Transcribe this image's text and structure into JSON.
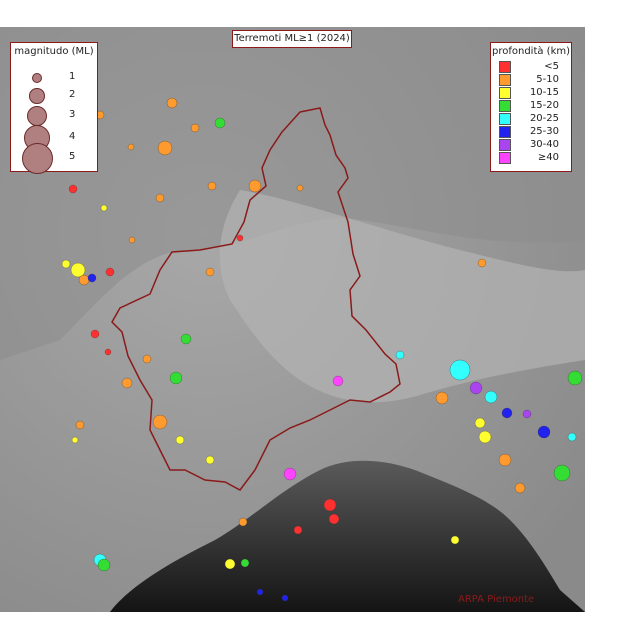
{
  "title": "Terremoti ML≥1 (2024)",
  "credit": "ARPA Piemonte",
  "magnitude_legend": {
    "title": "magnitudo (ML)",
    "items": [
      {
        "label": "1",
        "ml": 1
      },
      {
        "label": "2",
        "ml": 2
      },
      {
        "label": "3",
        "ml": 3
      },
      {
        "label": "4",
        "ml": 4
      },
      {
        "label": "5",
        "ml": 5
      }
    ]
  },
  "depth_legend": {
    "title": "profondità (km)",
    "items": [
      {
        "label": "<5",
        "color": "#ff3030"
      },
      {
        "label": "5-10",
        "color": "#ff9a2e"
      },
      {
        "label": "10-15",
        "color": "#ffff30"
      },
      {
        "label": "15-20",
        "color": "#33dd33"
      },
      {
        "label": "20-25",
        "color": "#33ffff"
      },
      {
        "label": "25-30",
        "color": "#2222ee"
      },
      {
        "label": "30-40",
        "color": "#aa44ee"
      },
      {
        "label": "≥40",
        "color": "#ff44ff"
      }
    ]
  }
}
